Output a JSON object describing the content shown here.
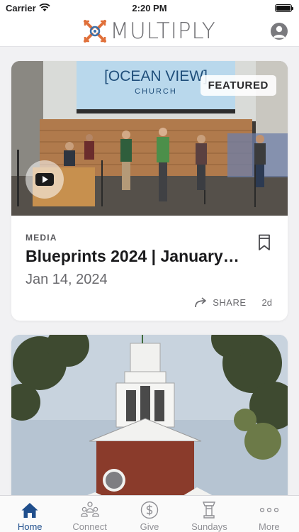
{
  "status_bar": {
    "carrier": "Carrier",
    "time": "2:20 PM"
  },
  "header": {
    "logo_text": "MULTIPLY"
  },
  "feed": {
    "cards": [
      {
        "image_text": [
          "[OCEAN VIEW]",
          "CHURCH"
        ],
        "badge": "FEATURED",
        "category": "MEDIA",
        "title": "Blueprints 2024 | January…",
        "date": "Jan 14, 2024",
        "share_label": "SHARE",
        "age": "2d"
      }
    ]
  },
  "tabs": [
    {
      "label": "Home",
      "icon": "home-icon",
      "active": true
    },
    {
      "label": "Connect",
      "icon": "people-icon",
      "active": false
    },
    {
      "label": "Give",
      "icon": "dollar-icon",
      "active": false
    },
    {
      "label": "Sundays",
      "icon": "pulpit-icon",
      "active": false
    },
    {
      "label": "More",
      "icon": "ellipsis-icon",
      "active": false
    }
  ],
  "colors": {
    "accent": "#1f4e8c",
    "logo_orange": "#e0703a",
    "logo_blue": "#3b6fa8"
  }
}
